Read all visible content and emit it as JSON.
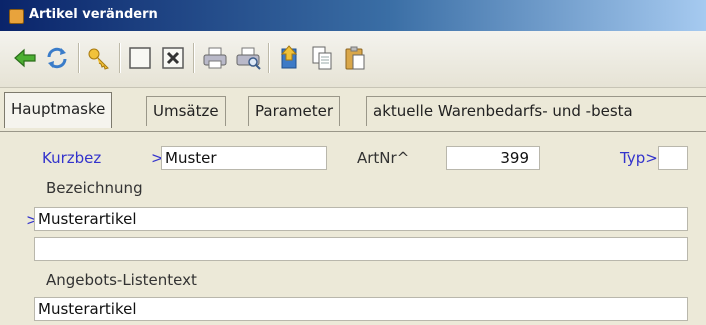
{
  "window": {
    "title": "Artikel verändern"
  },
  "toolbar": {
    "buttons": [
      {
        "icon": "back-arrow-icon"
      },
      {
        "icon": "refresh-icon"
      },
      {
        "icon": "key-icon"
      },
      {
        "icon": "empty-box-icon"
      },
      {
        "icon": "delete-box-icon"
      },
      {
        "icon": "printer-icon"
      },
      {
        "icon": "print-preview-icon"
      },
      {
        "icon": "import-icon"
      },
      {
        "icon": "copy-icon"
      },
      {
        "icon": "paste-icon"
      }
    ]
  },
  "tabs": [
    {
      "label": "Hauptmaske",
      "active": true
    },
    {
      "label": "Umsätze",
      "active": false
    },
    {
      "label": "Parameter",
      "active": false
    },
    {
      "label": "aktuelle Warenbedarfs- und -besta",
      "active": false
    }
  ],
  "form": {
    "kurzbez_label": "Kurzbez",
    "kurzbez_marker": ">",
    "kurzbez_value": "Muster",
    "artnr_label": "ArtNr^",
    "artnr_value": "399",
    "typ_label": "Typ>",
    "typ_value": "",
    "bezeichnung_label": "Bezeichnung",
    "bezeichnung_marker": ">",
    "bezeichnung_value": "Musterartikel",
    "bezeichnung2_value": "",
    "angebots_label": "Angebots-Listentext",
    "angebots_value": "Musterartikel"
  },
  "colors": {
    "titlebar_start": "#0a246a",
    "titlebar_end": "#a6caf0",
    "label_blue": "#3333cc"
  }
}
